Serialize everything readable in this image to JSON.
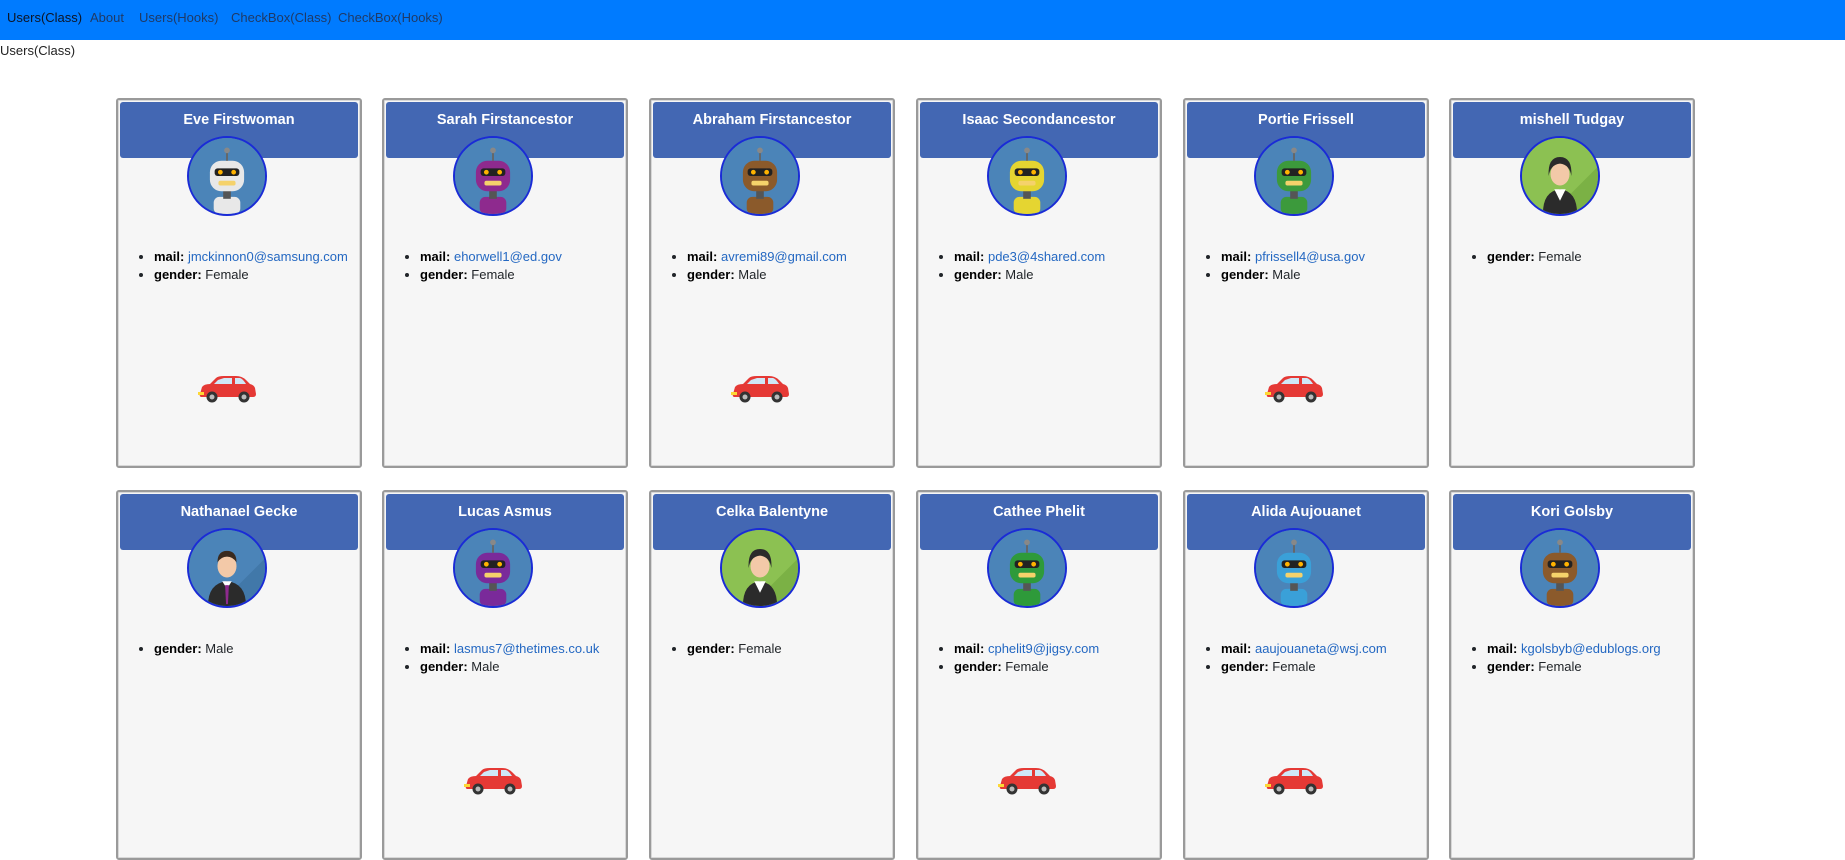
{
  "nav": {
    "items": [
      {
        "label": "Users(Class)",
        "active": true
      },
      {
        "label": "About",
        "active": false
      },
      {
        "label": "Users(Hooks)",
        "active": false
      },
      {
        "label": "CheckBox(Class)",
        "active": false
      },
      {
        "label": "CheckBox(Hooks)",
        "active": false
      }
    ]
  },
  "page": {
    "heading": "Users(Class)"
  },
  "labels": {
    "mail": "mail:",
    "gender": "gender:"
  },
  "colors": {
    "navbar": "#007bff",
    "card_header": "#4367b3",
    "avatar_border": "#1a2bd6",
    "link": "#2468c2",
    "car": "#e53935"
  },
  "users": [
    {
      "name": "Eve Firstwoman",
      "mail": "jmckinnon0@samsung.com",
      "gender": "Female",
      "has_car": true,
      "avatar": "robot-avatar",
      "avatar_color": "#e8e8e8"
    },
    {
      "name": "Sarah Firstancestor",
      "mail": "ehorwell1@ed.gov",
      "gender": "Female",
      "has_car": false,
      "avatar": "robot-avatar",
      "avatar_color": "#8e2a8e"
    },
    {
      "name": "Abraham Firstancestor",
      "mail": "avremi89@gmail.com",
      "gender": "Male",
      "has_car": true,
      "avatar": "robot-avatar",
      "avatar_color": "#8b5a2b"
    },
    {
      "name": "Isaac Secondancestor",
      "mail": "pde3@4shared.com",
      "gender": "Male",
      "has_car": false,
      "avatar": "robot-avatar",
      "avatar_color": "#e5d531"
    },
    {
      "name": "Portie Frissell",
      "mail": "pfrissell4@usa.gov",
      "gender": "Male",
      "has_car": true,
      "avatar": "robot-avatar",
      "avatar_color": "#3c9a3c"
    },
    {
      "name": "mishell Tudgay",
      "mail": null,
      "gender": "Female",
      "has_car": false,
      "avatar": "woman-avatar",
      "avatar_color": "#8cc152"
    },
    {
      "name": "Nathanael Gecke",
      "mail": null,
      "gender": "Male",
      "has_car": false,
      "avatar": "man-avatar",
      "avatar_color": "#4b84b8"
    },
    {
      "name": "Lucas Asmus",
      "mail": "lasmus7@thetimes.co.uk",
      "gender": "Male",
      "has_car": true,
      "avatar": "robot-avatar",
      "avatar_color": "#7a2a9a"
    },
    {
      "name": "Celka Balentyne",
      "mail": null,
      "gender": "Female",
      "has_car": false,
      "avatar": "woman-avatar",
      "avatar_color": "#8cc152"
    },
    {
      "name": "Cathee Phelit",
      "mail": "cphelit9@jigsy.com",
      "gender": "Female",
      "has_car": true,
      "avatar": "robot-avatar",
      "avatar_color": "#2e9a3a"
    },
    {
      "name": "Alida Aujouanet",
      "mail": "aaujouaneta@wsj.com",
      "gender": "Female",
      "has_car": true,
      "avatar": "robot-avatar",
      "avatar_color": "#3aa0d8"
    },
    {
      "name": "Kori Golsby",
      "mail": "kgolsbyb@edublogs.org",
      "gender": "Female",
      "has_car": false,
      "avatar": "robot-avatar",
      "avatar_color": "#8b5a2b"
    }
  ]
}
